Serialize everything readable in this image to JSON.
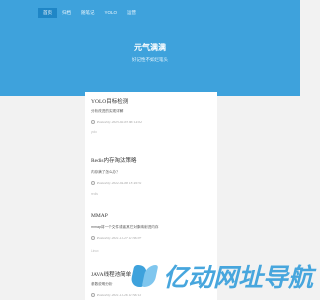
{
  "nav": {
    "items": [
      "首页",
      "归档",
      "随笔记",
      "YOLO",
      "运营"
    ],
    "active_index": 0
  },
  "site": {
    "title": "元气满满",
    "subtitle": "好记性不如烂笔头"
  },
  "posts": [
    {
      "title": "YOLO目标检测",
      "excerpt": "分析改进的实现详解",
      "meta": "Posted by 2023-02-03 06:14:04",
      "tag": "yolo"
    },
    {
      "title": "Redis内存淘汰策略",
      "excerpt": "内存满了怎么办？",
      "meta": "Posted by 2022-04-08 13:49:51",
      "tag": "redis"
    },
    {
      "title": "MMAP",
      "excerpt": "mmap将一个文件或者其它对象映射进内存",
      "meta": "Posted by 2021-11-27 11:36:07",
      "tag": "Linux"
    },
    {
      "title": "JAVA线程池简单",
      "excerpt": "参数说明分析",
      "meta": "Posted by 2021-11-26 11:56:12",
      "tag": ""
    }
  ],
  "watermark": {
    "text": "亿动网址导航"
  },
  "colors": {
    "hero": "#3ea2dc",
    "nav_active": "#1f86c6",
    "page_bg": "#f2f2f2"
  }
}
